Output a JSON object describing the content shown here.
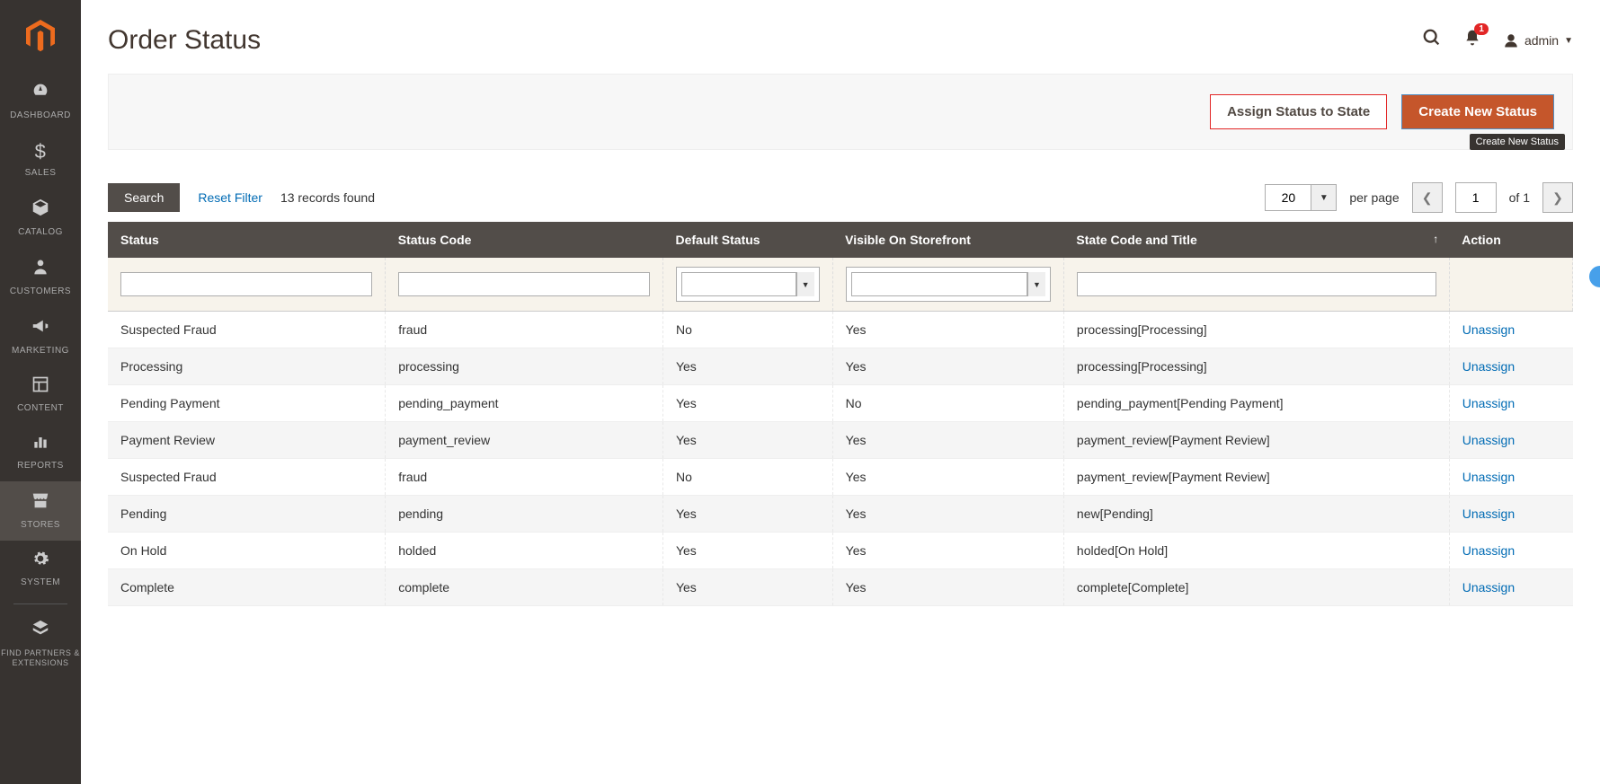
{
  "sidebar": {
    "items": [
      {
        "label": "DASHBOARD"
      },
      {
        "label": "SALES"
      },
      {
        "label": "CATALOG"
      },
      {
        "label": "CUSTOMERS"
      },
      {
        "label": "MARKETING"
      },
      {
        "label": "CONTENT"
      },
      {
        "label": "REPORTS"
      },
      {
        "label": "STORES"
      },
      {
        "label": "SYSTEM"
      },
      {
        "label": "FIND PARTNERS & EXTENSIONS"
      }
    ]
  },
  "header": {
    "title": "Order Status",
    "notification_count": "1",
    "user_name": "admin"
  },
  "actions": {
    "assign_label": "Assign Status to State",
    "create_label": "Create New Status",
    "tooltip": "Create New Status"
  },
  "toolbar": {
    "search_label": "Search",
    "reset_label": "Reset Filter",
    "records_found": "13 records found",
    "per_page_value": "20",
    "per_page_label": "per page",
    "page_value": "1",
    "page_total_label": "of 1"
  },
  "table": {
    "headers": {
      "status": "Status",
      "status_code": "Status Code",
      "default_status": "Default Status",
      "visible": "Visible On Storefront",
      "state": "State Code and Title",
      "action": "Action"
    },
    "action_label": "Unassign",
    "rows": [
      {
        "status": "Suspected Fraud",
        "code": "fraud",
        "default": "No",
        "visible": "Yes",
        "state": "processing[Processing]"
      },
      {
        "status": "Processing",
        "code": "processing",
        "default": "Yes",
        "visible": "Yes",
        "state": "processing[Processing]"
      },
      {
        "status": "Pending Payment",
        "code": "pending_payment",
        "default": "Yes",
        "visible": "No",
        "state": "pending_payment[Pending Payment]"
      },
      {
        "status": "Payment Review",
        "code": "payment_review",
        "default": "Yes",
        "visible": "Yes",
        "state": "payment_review[Payment Review]"
      },
      {
        "status": "Suspected Fraud",
        "code": "fraud",
        "default": "No",
        "visible": "Yes",
        "state": "payment_review[Payment Review]"
      },
      {
        "status": "Pending",
        "code": "pending",
        "default": "Yes",
        "visible": "Yes",
        "state": "new[Pending]"
      },
      {
        "status": "On Hold",
        "code": "holded",
        "default": "Yes",
        "visible": "Yes",
        "state": "holded[On Hold]"
      },
      {
        "status": "Complete",
        "code": "complete",
        "default": "Yes",
        "visible": "Yes",
        "state": "complete[Complete]"
      }
    ]
  }
}
